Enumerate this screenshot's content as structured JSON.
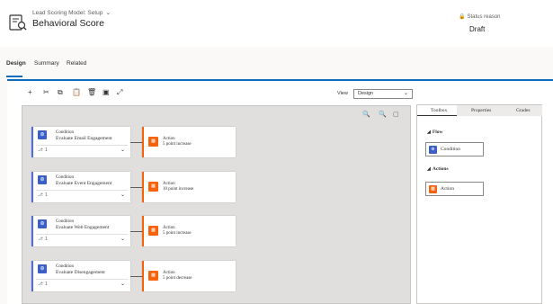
{
  "header": {
    "breadcrumb": "Lead Scoring Model: Setup",
    "title": "Behavioral Score",
    "status_label": "Status reason",
    "status_value": "Draft"
  },
  "tabs": [
    "Design",
    "Summary",
    "Related"
  ],
  "toolbar": {
    "view_label": "View",
    "view_value": "Design"
  },
  "flow": [
    {
      "condition": {
        "type": "Condition",
        "name": "Evaluate Email Engagement",
        "branches": "1"
      },
      "action": {
        "type": "Action",
        "detail": "5 point increase"
      }
    },
    {
      "condition": {
        "type": "Condition",
        "name": "Evaluate Event Engagement",
        "branches": "1"
      },
      "action": {
        "type": "Action",
        "detail": "10 point increase"
      }
    },
    {
      "condition": {
        "type": "Condition",
        "name": "Evaluate Web Engagement",
        "branches": "1"
      },
      "action": {
        "type": "Action",
        "detail": "5 point increase"
      }
    },
    {
      "condition": {
        "type": "Condition",
        "name": "Evaluate Disengagement",
        "branches": "1"
      },
      "action": {
        "type": "Action",
        "detail": "5 point decrease"
      }
    }
  ],
  "panel": {
    "tabs": [
      "Toolbox",
      "Properties",
      "Grades"
    ],
    "sections": [
      {
        "title": "Flow",
        "item": "Condition"
      },
      {
        "title": "Actions",
        "item": "Action"
      }
    ]
  },
  "colors": {
    "accent": "#0f6cbd",
    "condition": "#3b5fc4",
    "action": "#f7630c"
  }
}
